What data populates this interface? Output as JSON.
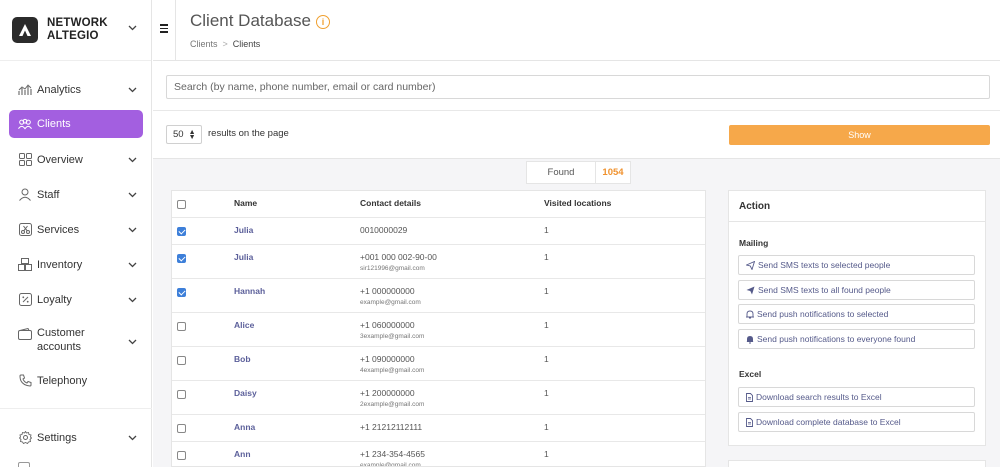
{
  "brand": {
    "name_line1": "NETWORK",
    "name_line2": "ALTEGIO"
  },
  "sidebar": {
    "items": [
      {
        "key": "analytics",
        "label": "Analytics",
        "icon": "chart-icon",
        "has_chevron": true
      },
      {
        "key": "clients",
        "label": "Clients",
        "icon": "users-icon",
        "has_chevron": false,
        "active": true
      },
      {
        "key": "overview",
        "label": "Overview",
        "icon": "grid-icon",
        "has_chevron": true
      },
      {
        "key": "staff",
        "label": "Staff",
        "icon": "person-icon",
        "has_chevron": true
      },
      {
        "key": "services",
        "label": "Services",
        "icon": "scissors-icon",
        "has_chevron": true
      },
      {
        "key": "inventory",
        "label": "Inventory",
        "icon": "boxes-icon",
        "has_chevron": true
      },
      {
        "key": "loyalty",
        "label": "Loyalty",
        "icon": "percent-icon",
        "has_chevron": true
      },
      {
        "key": "customer_accounts",
        "label_line1": "Customer",
        "label_line2": "accounts",
        "icon": "wallet-icon",
        "has_chevron": true
      },
      {
        "key": "telephony",
        "label": "Telephony",
        "icon": "phone-icon",
        "has_chevron": false
      }
    ],
    "settings": {
      "label": "Settings",
      "icon": "gear-icon"
    }
  },
  "header": {
    "title": "Client Database",
    "breadcrumb": [
      "Clients",
      "Clients"
    ],
    "breadcrumb_sep": ">"
  },
  "search": {
    "placeholder": "Search (by name, phone number, email or card number)"
  },
  "filters": {
    "per_page": "50",
    "per_page_label": "results on the page",
    "show_label": "Show"
  },
  "found": {
    "label": "Found",
    "count": "1054"
  },
  "table": {
    "columns": {
      "name": "Name",
      "contact": "Contact details",
      "visited": "Visited locations"
    },
    "rows": [
      {
        "checked": true,
        "name": "Julia",
        "phone": "0010000029",
        "email": "",
        "visited": "1"
      },
      {
        "checked": true,
        "name": "Julia",
        "phone": "+001 000 002-90-00",
        "email": "sir121996@gmail.com",
        "visited": "1"
      },
      {
        "checked": true,
        "name": "Hannah",
        "phone": "+1 000000000",
        "email": "example@gmail.com",
        "visited": "1"
      },
      {
        "checked": false,
        "name": "Alice",
        "phone": "+1 060000000",
        "email": "3example@gmail.com",
        "visited": "1"
      },
      {
        "checked": false,
        "name": "Bob",
        "phone": "+1 090000000",
        "email": "4example@gmail.com",
        "visited": "1"
      },
      {
        "checked": false,
        "name": "Daisy",
        "phone": "+1 200000000",
        "email": "2example@gmail.com",
        "visited": "1"
      },
      {
        "checked": false,
        "name": "Anna",
        "phone": "+1 21212112111",
        "email": "",
        "visited": "1"
      },
      {
        "checked": false,
        "name": "Ann",
        "phone": "+1 234-354-4565",
        "email": "example@gmail.com",
        "visited": "1"
      }
    ]
  },
  "actions": {
    "title": "Action",
    "mailing": {
      "title": "Mailing",
      "buttons": [
        {
          "label": "Send SMS texts to selected people",
          "icon": "send-outline-icon"
        },
        {
          "label": "Send SMS texts to all found people",
          "icon": "send-filled-icon"
        },
        {
          "label": "Send push notifications to selected",
          "icon": "bell-outline-icon"
        },
        {
          "label": "Send push notifications to everyone found",
          "icon": "bell-filled-icon"
        }
      ]
    },
    "excel": {
      "title": "Excel",
      "buttons": [
        {
          "label": "Download search results to Excel",
          "icon": "file-icon"
        },
        {
          "label": "Download complete database to Excel",
          "icon": "file-icon"
        }
      ]
    }
  },
  "colors": {
    "accent": "#a35fe0",
    "orange": "#f6a84a",
    "found": "#f0922e",
    "link": "#5b5f9a",
    "checkbox": "#3d7fd9"
  }
}
